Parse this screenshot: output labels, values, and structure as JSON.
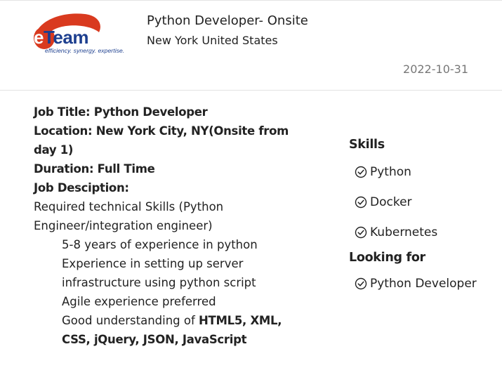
{
  "logo": {
    "wordmark": "eTeam",
    "tagline": "efficiency. synergy. expertise."
  },
  "header": {
    "job_heading": "Python Developer- Onsite",
    "location": "New York United States",
    "date": "2022-10-31"
  },
  "description": {
    "job_title": "Job Title: Python Developer",
    "location": "Location: New York City, NY(Onsite from day 1)",
    "duration": "Duration: Full Time",
    "job_description_label": "Job Desciption:",
    "required_skills": "Required technical Skills (Python Engineer/integration engineer)",
    "bullets": [
      "5-8 years of experience in python",
      "Experience in setting up server infrastructure using python script",
      "Agile experience preferred"
    ],
    "last_bullet_prefix": "Good understanding of ",
    "last_bullet_bold": "HTML5, XML, CSS, jQuery, JSON, JavaScript"
  },
  "sidebar": {
    "skills_heading": "Skills",
    "skills": [
      "Python",
      "Docker",
      "Kubernetes"
    ],
    "looking_for_heading": "Looking for",
    "looking_for": [
      "Python Developer"
    ]
  },
  "colors": {
    "brand_red": "#d93a1f",
    "brand_blue": "#1d3f8f",
    "date_gray": "#777777",
    "divider": "#e3e3e3"
  },
  "icons": {
    "list_item": "check-circle-icon"
  }
}
